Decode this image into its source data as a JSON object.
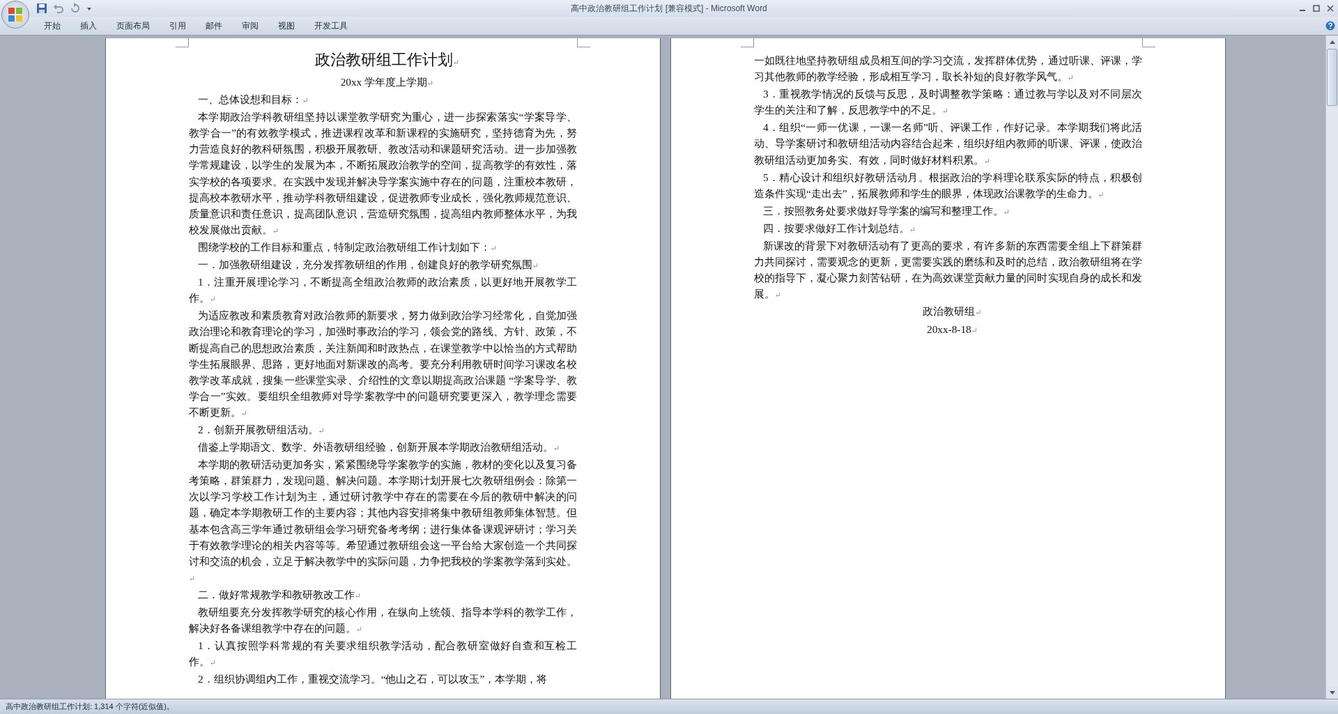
{
  "window": {
    "title": "高中政治教研组工作计划 [兼容模式] - Microsoft Word"
  },
  "tabs": [
    {
      "label": "开始",
      "selected": false
    },
    {
      "label": "插入",
      "selected": false
    },
    {
      "label": "页面布局",
      "selected": false
    },
    {
      "label": "引用",
      "selected": false
    },
    {
      "label": "邮件",
      "selected": false
    },
    {
      "label": "审阅",
      "selected": false
    },
    {
      "label": "视图",
      "selected": false
    },
    {
      "label": "开发工具",
      "selected": false
    }
  ],
  "paragraph_mark": "↵",
  "pages": [
    {
      "paragraphs": [
        {
          "kind": "title",
          "text": "政治教研组工作计划",
          "end_mark": true
        },
        {
          "kind": "center",
          "text": "20xx 学年度上学期",
          "end_mark": true
        },
        {
          "kind": "body",
          "text": "一、总体设想和目标：",
          "end_mark": true
        },
        {
          "kind": "body",
          "text": "本学期政治学科教研组坚持以课堂教学研究为重心，进一步探索落实“学案导学、教学合一”的有效教学模式，推进课程改革和新课程的实施研究，坚持德育为先，努力营造良好的教科研氛围，积极开展教研、教改活动和课题研究活动。进一步加强教学常规建设，以学生的发展为本，不断拓展政治教学的空间，提高教学的有效性，落实学校的各项要求。在实践中发现并解决导学案实施中存在的问题，注重校本教研，提高校本教研水平，推动学科教研组建设，促进教师专业成长，强化教师规范意识、质量意识和责任意识，提高团队意识，营造研究氛围，提高组内教师整体水平，为我校发展做出贡献。",
          "end_mark": true
        },
        {
          "kind": "body",
          "text": "围绕学校的工作目标和重点，特制定政治教研组工作计划如下：",
          "end_mark": true
        },
        {
          "kind": "body",
          "text": "一．加强教研组建设，充分发挥教研组的作用，创建良好的教学研究氛围",
          "end_mark": true
        },
        {
          "kind": "body",
          "text": "1．注重开展理论学习，不断提高全组政治教师的政治素质，以更好地开展教学工作。",
          "end_mark": true
        },
        {
          "kind": "body",
          "text": "为适应教改和素质教育对政治教师的新要求，努力做到政治学习经常化，自觉加强政治理论和教育理论的学习，加强时事政治的学习，领会党的路线、方针、政策，不断提高自己的思想政治素质，关注新闻和时政热点，在课堂教学中以恰当的方式帮助学生拓展眼界、思路，更好地面对新课改的高考。要充分利用教研时间学习课改名校教学改革成就，搜集一些课堂实录、介绍性的文章以期提高政治课题 “学案导学、教学合一”实效。要组织全组教师对导学案教学中的问题研究要更深入，教学理念需要不断更新。",
          "end_mark": true
        },
        {
          "kind": "body",
          "text": "2．创新开展教研组活动。",
          "end_mark": true
        },
        {
          "kind": "body",
          "text": "借鉴上学期语文、数学、外语教研组经验，创新开展本学期政治教研组活动。",
          "end_mark": true
        },
        {
          "kind": "body",
          "text": "本学期的教研活动更加务实，紧紧围绕导学案教学的实施，教材的变化以及复习备考策略，群策群力，发现问题、解决问题。本学期计划开展七次教研组例会：除第一次以学习学校工作计划为主，通过研讨教学中存在的需要在今后的教研中解决的问题，确定本学期教研工作的主要内容；其他内容安排将集中教研组教师集体智慧。但基本包含高三学年通过教研组会学习研究备考考纲；进行集体备课观评研讨；学习关于有效教学理论的相关内容等等。希望通过教研组会这一平台给大家创造一个共同探讨和交流的机会，立足于解决教学中的实际问题，力争把我校的学案教学落到实处。",
          "end_mark": true
        },
        {
          "kind": "body",
          "text": "二．做好常规教学和教研教改工作",
          "end_mark": true
        },
        {
          "kind": "body",
          "text": "教研组要充分发挥教学研究的核心作用，在纵向上统领、指导本学科的教学工作，解决好各备课组教学中存在的问题。",
          "end_mark": true
        },
        {
          "kind": "body",
          "text": "1．认真按照学科常规的有关要求组织教学活动，配合教研室做好自查和互检工作。",
          "end_mark": true
        },
        {
          "kind": "body",
          "text": "2．组织协调组内工作，重视交流学习。“他山之石，可以攻玉”，本学期，将",
          "end_mark": false
        }
      ]
    },
    {
      "paragraphs": [
        {
          "kind": "continued",
          "text": "一如既往地坚持教研组成员相互间的学习交流，发挥群体优势，通过听课、评课，学习其他教师的教学经验，形成相互学习，取长补短的良好教学风气。",
          "end_mark": true
        },
        {
          "kind": "body",
          "text": "3．重视教学情况的反馈与反思，及时调整教学策略：通过教与学以及对不同层次学生的关注和了解，反思教学中的不足。",
          "end_mark": true
        },
        {
          "kind": "body",
          "text": "4．组织“一师一优课，一课一名师”听、评课工作，作好记录。本学期我们将此活动、导学案研讨和教研组活动内容结合起来，组织好组内教师的听课、评课，使政治教研组活动更加务实、有效，同时做好材料积累。",
          "end_mark": true
        },
        {
          "kind": "body",
          "text": "5．精心设计和组织好教研活动月。根据政治的学科理论联系实际的特点，积极创造条件实现“走出去”，拓展教师和学生的眼界，体现政治课教学的生命力。",
          "end_mark": true
        },
        {
          "kind": "body",
          "text": "三．按照教务处要求做好导学案的编写和整理工作。",
          "end_mark": true
        },
        {
          "kind": "body",
          "text": "四．按要求做好工作计划总结。",
          "end_mark": true
        },
        {
          "kind": "body",
          "text": "新课改的背景下对教研活动有了更高的要求，有许多新的东西需要全组上下群策群力共同探讨，需要观念的更新，更需要实践的磨练和及时的总结，政治教研组将在学校的指导下，凝心聚力刻苦钻研，在为高效课堂贡献力量的同时实现自身的成长和发展。",
          "end_mark": true
        },
        {
          "kind": "center",
          "text": "政治教研组",
          "end_mark": true
        },
        {
          "kind": "center",
          "text": "20xx-8-18",
          "end_mark": true
        }
      ]
    }
  ],
  "status_bar": {
    "text": "高中政治教研组工作计划: 1,314 个字符(近似值)。"
  }
}
